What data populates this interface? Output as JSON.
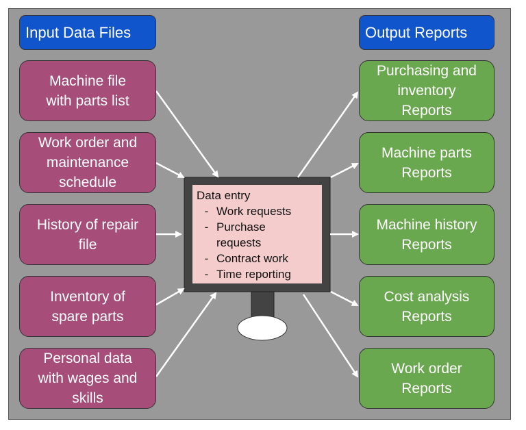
{
  "input_header": "Input Data Files",
  "output_header": "Output Reports",
  "inputs": [
    {
      "label": "Machine file\nwith parts list"
    },
    {
      "label": "Work order and\nmaintenance\nschedule"
    },
    {
      "label": "History of repair\nfile"
    },
    {
      "label": "Inventory of\nspare parts"
    },
    {
      "label": "Personal data\nwith wages and\nskills"
    }
  ],
  "outputs": [
    {
      "label": "Purchasing and\ninventory\nReports"
    },
    {
      "label": "Machine parts\nReports"
    },
    {
      "label": "Machine history\nReports"
    },
    {
      "label": "Cost analysis\nReports"
    },
    {
      "label": "Work order\nReports"
    }
  ],
  "computer": {
    "title": "Data entry",
    "items": [
      {
        "bullet": "-",
        "text": "Work requests"
      },
      {
        "bullet": "-",
        "text": "Purchase"
      },
      {
        "bullet": "",
        "text": "requests"
      },
      {
        "bullet": "-",
        "text": "Contract work"
      },
      {
        "bullet": "-",
        "text": "Time reporting"
      }
    ]
  },
  "colors": {
    "header": "#1155cc",
    "input": "#a64d79",
    "output": "#6aa84f",
    "screen": "#f4cccc",
    "monitor": "#434343",
    "background": "#999999"
  }
}
